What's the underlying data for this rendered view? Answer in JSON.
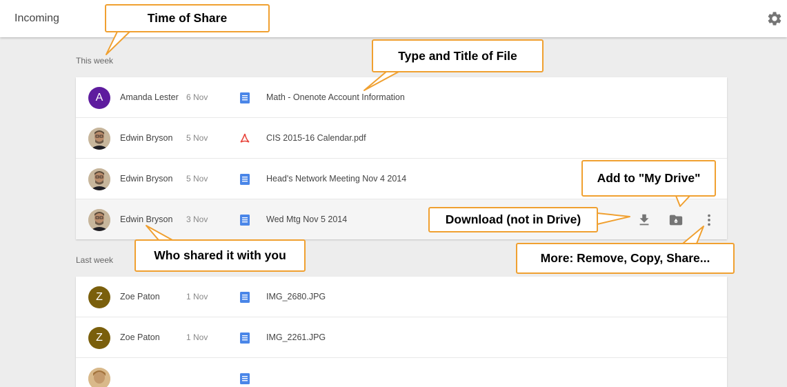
{
  "app": {
    "title": "Incoming",
    "settings_icon": "gear-icon"
  },
  "sections": [
    {
      "label": "This week",
      "rows": [
        {
          "sharer": "Amanda Lester",
          "date": "6 Nov",
          "avatar": {
            "type": "letter",
            "letter": "A",
            "color": "#5e1c9e"
          },
          "file_type": "doc",
          "file_name": "Math - Onenote Account Information"
        },
        {
          "sharer": "Edwin Bryson",
          "date": "5 Nov",
          "avatar": {
            "type": "photo"
          },
          "file_type": "pdf",
          "file_name": "CIS 2015-16 Calendar.pdf"
        },
        {
          "sharer": "Edwin Bryson",
          "date": "5 Nov",
          "avatar": {
            "type": "photo"
          },
          "file_type": "doc",
          "file_name": "Head's Network Meeting Nov 4 2014"
        },
        {
          "sharer": "Edwin Bryson",
          "date": "3 Nov",
          "avatar": {
            "type": "photo"
          },
          "file_type": "doc",
          "file_name": "Wed Mtg Nov 5 2014",
          "hovered": true
        }
      ]
    },
    {
      "label": "Last week",
      "rows": [
        {
          "sharer": "Zoe Paton",
          "date": "1 Nov",
          "avatar": {
            "type": "letter",
            "letter": "Z",
            "color": "#7a5f0c"
          },
          "file_type": "doc",
          "file_name": "IMG_2680.JPG"
        },
        {
          "sharer": "Zoe Paton",
          "date": "1 Nov",
          "avatar": {
            "type": "letter",
            "letter": "Z",
            "color": "#7a5f0c"
          },
          "file_type": "doc",
          "file_name": "IMG_2261.JPG"
        },
        {
          "sharer": "",
          "date": "",
          "avatar": {
            "type": "photo"
          },
          "file_type": "doc",
          "file_name": ""
        }
      ]
    }
  ],
  "row_actions": [
    "download-icon",
    "add-to-drive-icon",
    "more-vert-icon"
  ],
  "callouts": {
    "time": "Time of Share",
    "type_title": "Type and Title of File",
    "add_drive": "Add to \"My Drive\"",
    "download": "Download (not in Drive)",
    "who": "Who shared it with you",
    "more": "More: Remove, Copy, Share..."
  },
  "colors": {
    "doc_icon": "#4a86e8",
    "pdf_icon": "#e8453c",
    "callout_border": "#f0a030"
  }
}
